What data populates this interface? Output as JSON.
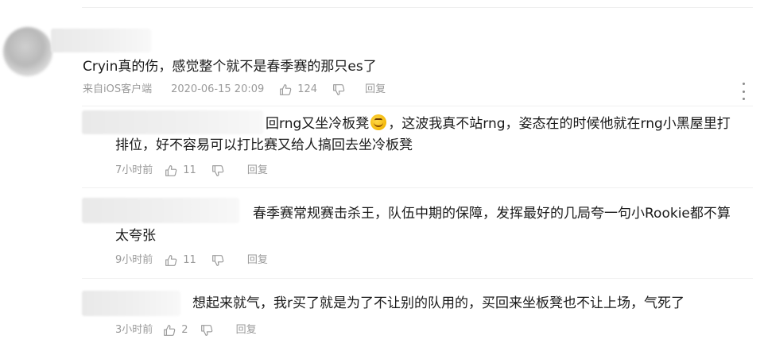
{
  "main_comment": {
    "text": "Cryin真的伤，感觉整个就不是春季赛的那只es了",
    "source": "来自iOS客户端",
    "timestamp": "2020-06-15 20:09",
    "likes": "124",
    "reply_label": "回复"
  },
  "replies": [
    {
      "line1_before_emoji": "回rng又坐冷板凳",
      "line1_after_emoji": "，这波我真不站rng，姿态在的时候他就在rng小黑屋里打",
      "line2": "排位，好不容易可以打比赛又给人搞回去坐冷板凳",
      "time": "7小时前",
      "likes": "11",
      "reply_label": "回复"
    },
    {
      "line1": "春季赛常规赛击杀王，队伍中期的保障，发挥最好的几局夸一句小Rookie都不算",
      "line2": "太夸张",
      "time": "9小时前",
      "likes": "11",
      "reply_label": "回复"
    },
    {
      "line1": "想起来就气，我r买了就是为了不让别的队用的，买回来坐板凳也不让上场，气死了",
      "time": "3小时前",
      "likes": "2",
      "reply_label": "回复"
    }
  ],
  "colors": {
    "text": "#1a1a1a",
    "meta": "#9a9a9a",
    "divider": "#f0f0f0"
  },
  "icons": [
    "thumbs-up-icon",
    "thumbs-down-icon",
    "more-vertical-icon",
    "emoji-icon"
  ]
}
